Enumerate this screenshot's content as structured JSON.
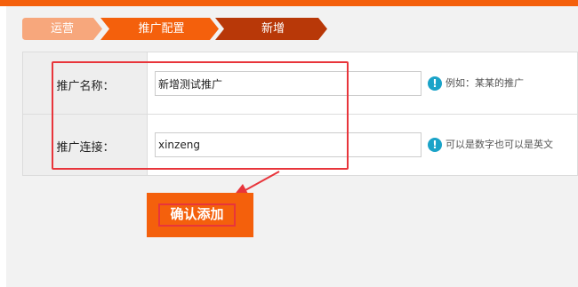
{
  "breadcrumb": [
    {
      "label": "运营",
      "color": "#f7a77c"
    },
    {
      "label": "推广配置",
      "color": "#f4600c"
    },
    {
      "label": "新增",
      "color": "#b83808"
    }
  ],
  "form": {
    "fields": [
      {
        "label": "推广名称：",
        "value": "新增测试推广",
        "hint": "例如：某某的推广"
      },
      {
        "label": "推广连接：",
        "value": "xinzeng",
        "hint": "可以是数字也可以是英文"
      }
    ]
  },
  "confirm_button": {
    "label": "确认添加"
  },
  "icons": {
    "hint_icon": "info-circle-icon",
    "hint_glyph": "!"
  },
  "colors": {
    "accent": "#f4600c",
    "annotation": "#e8353b",
    "info": "#1aa3c8"
  }
}
